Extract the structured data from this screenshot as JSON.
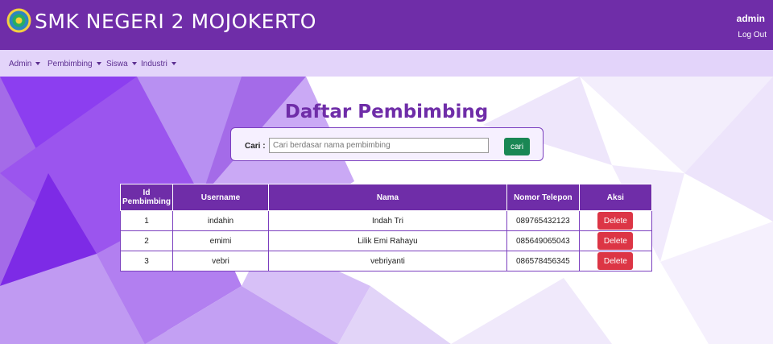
{
  "header": {
    "school_name": "SMK NEGERI 2 MOJOKERTO",
    "user_name": "admin",
    "logout_label": "Log Out"
  },
  "nav": {
    "items": [
      {
        "label": "Admin"
      },
      {
        "label": "Pembimbing"
      },
      {
        "label": "Siswa"
      },
      {
        "label": "Industri"
      }
    ]
  },
  "main": {
    "title": "Daftar Pembimbing",
    "search": {
      "label": "Cari :",
      "placeholder": "Cari berdasar nama pembimbing",
      "value": "",
      "button_label": "cari"
    },
    "table": {
      "headers": [
        "Id Pembimbing",
        "Username",
        "Nama",
        "Nomor Telepon",
        "Aksi"
      ],
      "rows": [
        {
          "id": "1",
          "username": "indahin",
          "nama": "Indah Tri",
          "telepon": "089765432123",
          "action": "Delete"
        },
        {
          "id": "2",
          "username": "emimi",
          "nama": "Lilik Emi Rahayu",
          "telepon": "085649065043",
          "action": "Delete"
        },
        {
          "id": "3",
          "username": "vebri",
          "nama": "vebriyanti",
          "telepon": "086578456345",
          "action": "Delete"
        }
      ]
    }
  },
  "colors": {
    "primary": "#6f2da8",
    "nav_bg": "#e3d4fa",
    "search_button": "#198754",
    "delete_button": "#dc3545"
  }
}
